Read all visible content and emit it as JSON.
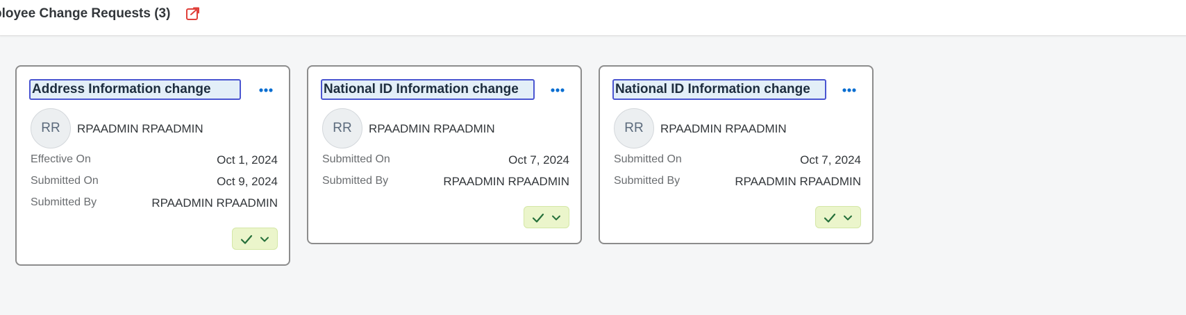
{
  "header": {
    "title": "ployee Change Requests (3)",
    "export_icon": "share-external-icon"
  },
  "colors": {
    "accent_blue": "#0a6ed1",
    "title_highlight_bg": "#e3eff8",
    "title_focus_border": "#4a55d1",
    "status_bg": "#ebf5cb",
    "status_icon": "#256f3a",
    "export_icon_color": "#e0403a"
  },
  "cards": [
    {
      "title": "Address Information change",
      "avatar_initials": "RR",
      "person": "RPAADMIN RPAADMIN",
      "fields": [
        {
          "label": "Effective On",
          "value": "Oct 1, 2024"
        },
        {
          "label": "Submitted On",
          "value": "Oct 9, 2024"
        },
        {
          "label": "Submitted By",
          "value": "RPAADMIN RPAADMIN"
        }
      ],
      "status_icon": "check-icon",
      "menu_icon": "more-horizontal-icon"
    },
    {
      "title": "National ID Information change",
      "avatar_initials": "RR",
      "person": "RPAADMIN RPAADMIN",
      "fields": [
        {
          "label": "Submitted On",
          "value": "Oct 7, 2024"
        },
        {
          "label": "Submitted By",
          "value": "RPAADMIN RPAADMIN"
        }
      ],
      "status_icon": "check-icon",
      "menu_icon": "more-horizontal-icon"
    },
    {
      "title": "National ID Information change",
      "avatar_initials": "RR",
      "person": "RPAADMIN RPAADMIN",
      "fields": [
        {
          "label": "Submitted On",
          "value": "Oct 7, 2024"
        },
        {
          "label": "Submitted By",
          "value": "RPAADMIN RPAADMIN"
        }
      ],
      "status_icon": "check-icon",
      "menu_icon": "more-horizontal-icon"
    }
  ]
}
